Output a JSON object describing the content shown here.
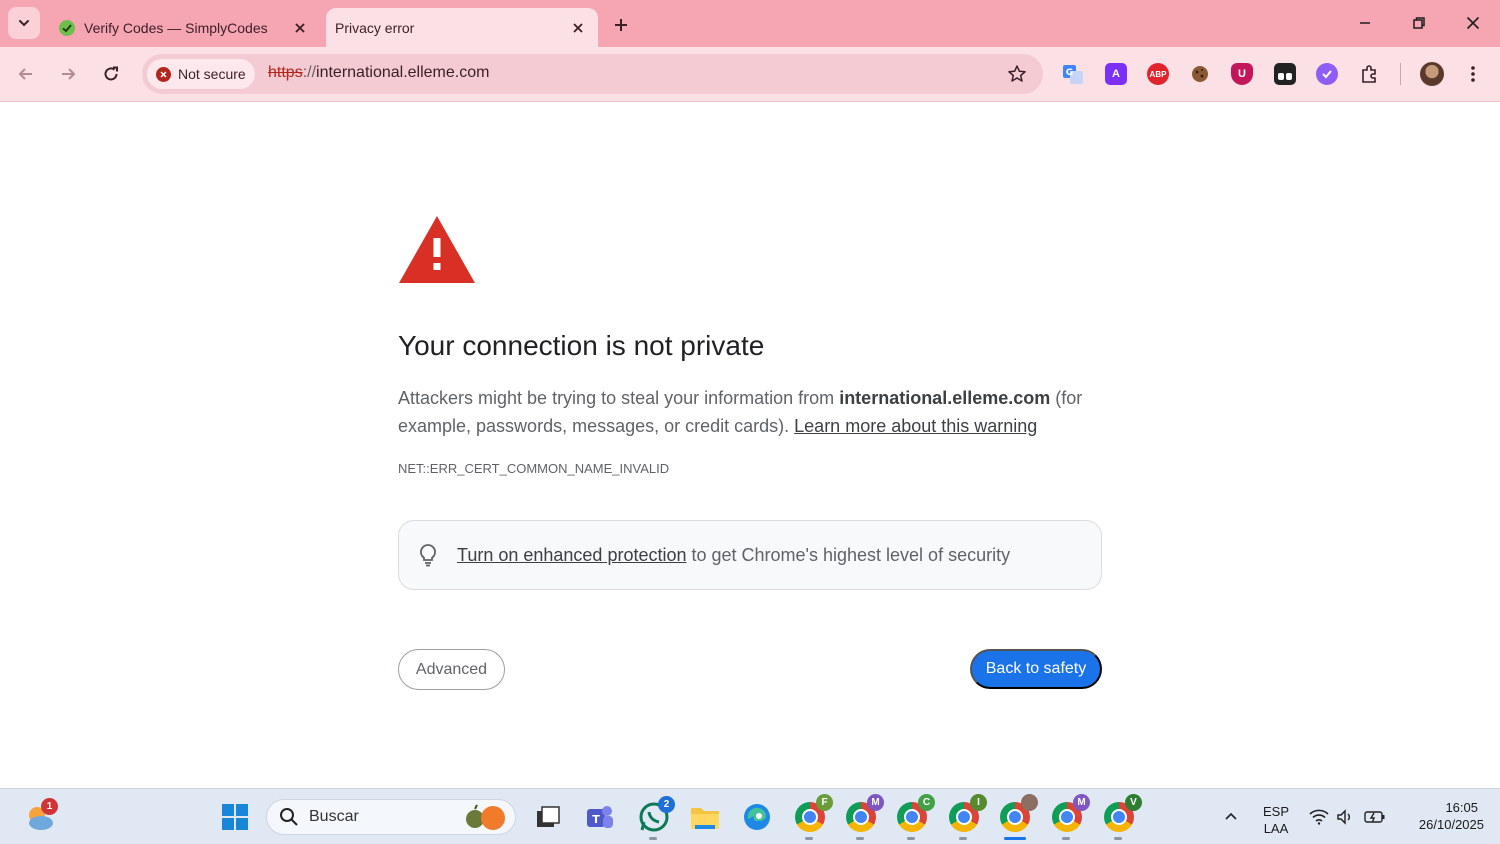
{
  "browser": {
    "tabs": [
      {
        "title": "Verify Codes — SimplyCodes",
        "active": false
      },
      {
        "title": "Privacy error",
        "active": true
      }
    ],
    "security_chip": "Not secure",
    "url": {
      "scheme": "https",
      "separator": "://",
      "host": "international.elleme.com"
    },
    "extensions": [
      {
        "name": "google-translate-icon",
        "color": "#4285f4"
      },
      {
        "name": "font-a-icon",
        "color": "#7b2ff7",
        "text": "A"
      },
      {
        "name": "adblock-plus-icon",
        "color": "#e0242b",
        "text": "ABP"
      },
      {
        "name": "cookie-icon",
        "color": "#7a4a2a"
      },
      {
        "name": "ublock-icon",
        "color": "#c2185b",
        "text": "U"
      },
      {
        "name": "panel-icon",
        "color": "#222222"
      },
      {
        "name": "purple-extension-icon",
        "color": "#8e5cf6"
      }
    ],
    "colors": {
      "frame": "#f6a5b2",
      "toolbar": "#fbe0e5"
    }
  },
  "page": {
    "heading": "Your connection is not private",
    "desc_prefix": "Attackers might be trying to steal your information from ",
    "desc_host": "international.elleme.com",
    "desc_suffix": " (for example, passwords, messages, or credit cards). ",
    "learn_more": "Learn more about this warning",
    "error_code": "NET::ERR_CERT_COMMON_NAME_INVALID",
    "protection_link": "Turn on enhanced protection",
    "protection_rest": " to get Chrome's highest level of security",
    "advanced_label": "Advanced",
    "back_label": "Back to safety",
    "colors": {
      "warning": "#d93025",
      "primary": "#1a73e8"
    }
  },
  "taskbar": {
    "weather_badge": "1",
    "search_label": "Buscar",
    "whatsapp_badge": "2",
    "chrome_profiles": [
      "F",
      "M",
      "C",
      "I",
      "",
      "M",
      "V"
    ],
    "profile_colors": [
      "#6a9c3a",
      "#7e57c2",
      "#43a047",
      "#558b2f",
      "#8d6e63",
      "#7e57c2",
      "#2e7d32"
    ],
    "language": "ESP",
    "layout": "LAA",
    "time": "16:05",
    "date": "26/10/2025"
  }
}
